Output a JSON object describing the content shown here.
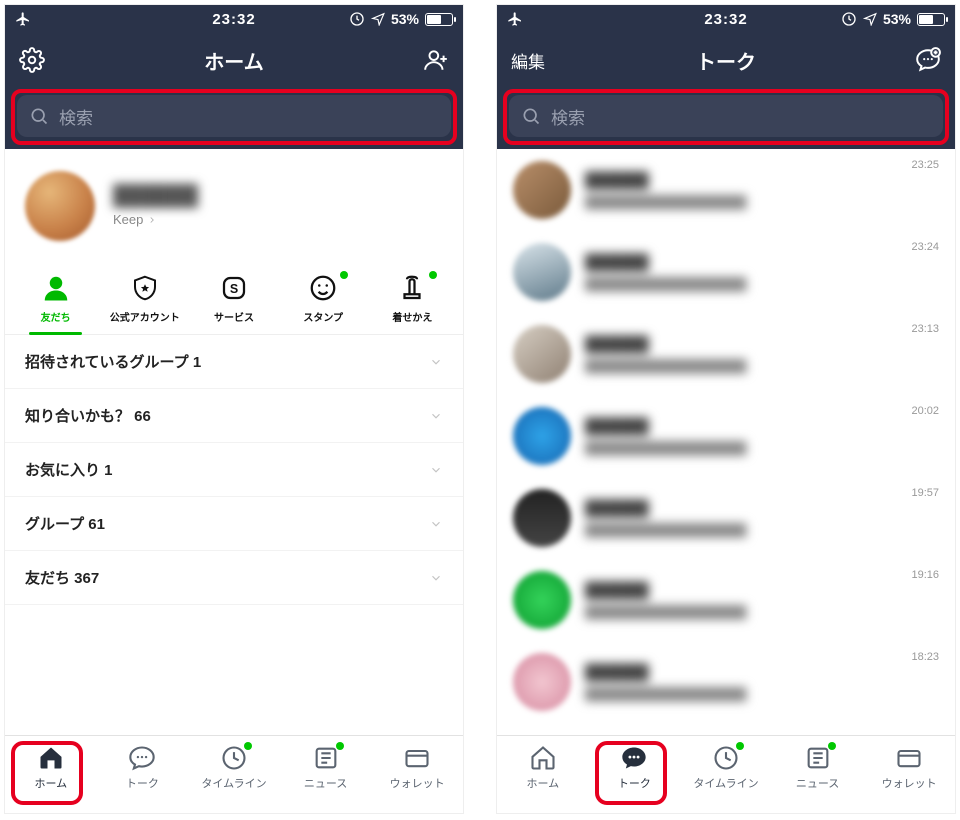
{
  "status": {
    "time": "23:32",
    "battery": "53%"
  },
  "left": {
    "title": "ホーム",
    "search_placeholder": "検索",
    "profile_keep": "Keep",
    "cats": [
      {
        "label": "友だち"
      },
      {
        "label": "公式アカウント"
      },
      {
        "label": "サービス"
      },
      {
        "label": "スタンプ"
      },
      {
        "label": "着せかえ"
      }
    ],
    "rows": [
      {
        "label": "招待されているグループ 1"
      },
      {
        "label": "知り合いかも？ 66"
      },
      {
        "label": "お気に入り 1"
      },
      {
        "label": "グループ 61"
      },
      {
        "label": "友だち 367"
      }
    ],
    "tabs": [
      {
        "label": "ホーム"
      },
      {
        "label": "トーク"
      },
      {
        "label": "タイムライン"
      },
      {
        "label": "ニュース"
      },
      {
        "label": "ウォレット"
      }
    ]
  },
  "right": {
    "edit": "編集",
    "title": "トーク",
    "search_placeholder": "検索",
    "chats": [
      {
        "time": "23:25",
        "avatar": "linear-gradient(135deg,#b98f6a,#7a5a3b)"
      },
      {
        "time": "23:24",
        "avatar": "linear-gradient(160deg,#d9e4ea,#5f7a8a)"
      },
      {
        "time": "23:13",
        "avatar": "linear-gradient(140deg,#d7cfc4,#8f8072)"
      },
      {
        "time": "20:02",
        "avatar": "radial-gradient(circle,#2ea3e8,#1665b0)"
      },
      {
        "time": "19:57",
        "avatar": "linear-gradient(#222,#444)"
      },
      {
        "time": "19:16",
        "avatar": "radial-gradient(circle,#34d35a,#0b9a2e)"
      },
      {
        "time": "18:23",
        "avatar": "radial-gradient(circle,#f2c6d0,#d68aa0)"
      }
    ],
    "tabs": [
      {
        "label": "ホーム"
      },
      {
        "label": "トーク"
      },
      {
        "label": "タイムライン"
      },
      {
        "label": "ニュース"
      },
      {
        "label": "ウォレット"
      }
    ]
  }
}
